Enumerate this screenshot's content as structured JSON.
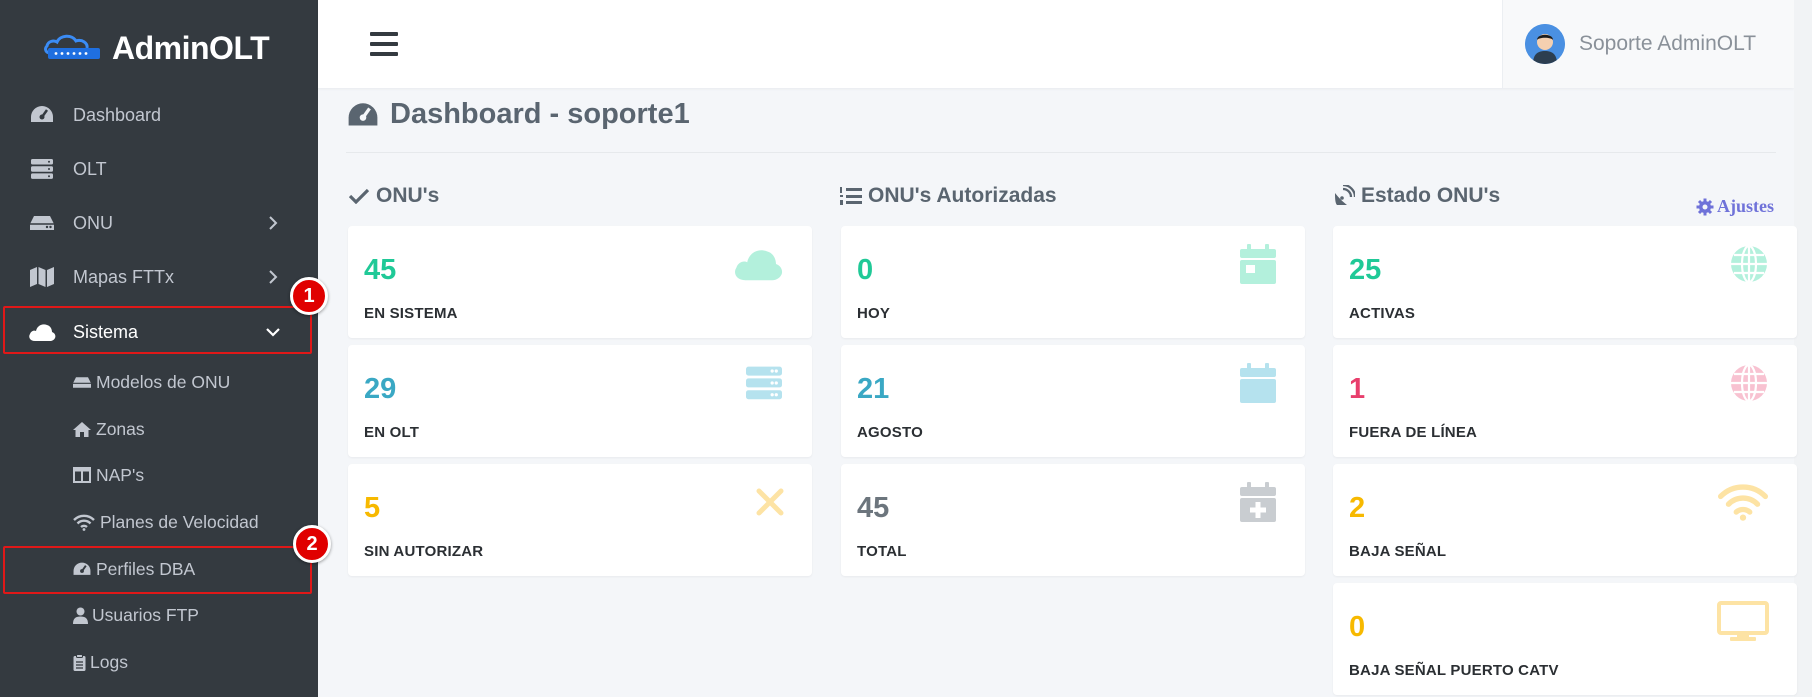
{
  "brand": {
    "name": "AdminOLT"
  },
  "header": {
    "user_name": "Soporte AdminOLT"
  },
  "sidebar": {
    "items": [
      {
        "label": "Dashboard",
        "icon": "gauge-icon"
      },
      {
        "label": "OLT",
        "icon": "server-icon"
      },
      {
        "label": "ONU",
        "icon": "hdd-icon"
      },
      {
        "label": "Mapas FTTx",
        "icon": "map-icon"
      },
      {
        "label": "Sistema",
        "icon": "cloud-icon"
      }
    ],
    "subitems": [
      {
        "label": "Modelos de ONU",
        "icon": "hdd-icon"
      },
      {
        "label": "Zonas",
        "icon": "home-icon"
      },
      {
        "label": "NAP's",
        "icon": "columns-icon"
      },
      {
        "label": "Planes de Velocidad",
        "icon": "wifi-icon"
      },
      {
        "label": "Perfiles DBA",
        "icon": "gauge-icon"
      },
      {
        "label": "Usuarios FTP",
        "icon": "user-icon"
      },
      {
        "label": "Logs",
        "icon": "clipboard-icon"
      }
    ]
  },
  "annotations": {
    "badge1": "1",
    "badge2": "2"
  },
  "page": {
    "title": "Dashboard - soporte1"
  },
  "sections": {
    "onus": {
      "title": "ONU's"
    },
    "autorizadas": {
      "title": "ONU's Autorizadas"
    },
    "estado": {
      "title": "Estado ONU's",
      "settings_label": "Ajustes"
    }
  },
  "cards": {
    "onus": [
      {
        "value": "45",
        "label": "EN SISTEMA",
        "icon": "cloud-icon"
      },
      {
        "value": "29",
        "label": "EN OLT",
        "icon": "server-icon"
      },
      {
        "value": "5",
        "label": "SIN AUTORIZAR",
        "icon": "times-icon"
      }
    ],
    "autorizadas": [
      {
        "value": "0",
        "label": "HOY",
        "icon": "calendar-day-icon"
      },
      {
        "value": "21",
        "label": "AGOSTO",
        "icon": "calendar-icon"
      },
      {
        "value": "45",
        "label": "TOTAL",
        "icon": "calendar-plus-icon"
      }
    ],
    "estado": [
      {
        "value": "25",
        "label": "ACTIVAS",
        "icon": "globe-icon"
      },
      {
        "value": "1",
        "label": "FUERA DE LÍNEA",
        "icon": "globe-icon"
      },
      {
        "value": "2",
        "label": "BAJA SEÑAL",
        "icon": "wifi-icon"
      },
      {
        "value": "0",
        "label": "BAJA SEÑAL PUERTO CATV",
        "icon": "tv-icon"
      }
    ]
  },
  "colors": {
    "sidebar_bg": "#343a40",
    "teal": "#20c997",
    "cyan": "#3aa8c4",
    "yellow": "#f7b900",
    "gray": "#6c757d",
    "pink": "#e83e6c",
    "highlight_red": "#e01818"
  }
}
